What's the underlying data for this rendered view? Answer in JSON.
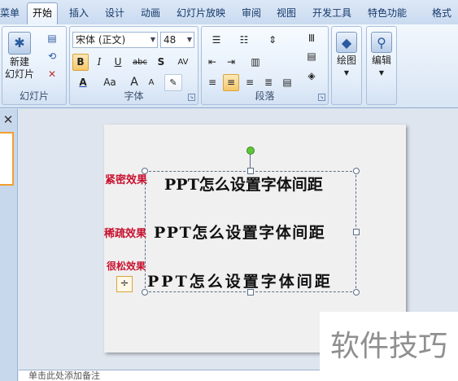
{
  "tabs": {
    "menu": "菜单",
    "home": "开始",
    "insert": "插入",
    "design": "设计",
    "animation": "动画",
    "slideshow": "幻灯片放映",
    "review": "审阅",
    "view": "视图",
    "developer": "开发工具",
    "special": "特色功能",
    "format": "格式"
  },
  "slides_group": {
    "new_slide": "新建",
    "new_slide2": "幻灯片",
    "label": "幻灯片"
  },
  "font_group": {
    "font_name": "宋体 (正文)",
    "font_size": "48",
    "bold": "B",
    "italic": "I",
    "underline": "U",
    "strike": "abc",
    "shadow": "S",
    "spacing": "AV",
    "color": "A",
    "case": "Aa",
    "grow": "A",
    "shrink": "A",
    "label": "字体"
  },
  "paragraph_group": {
    "label": "段落"
  },
  "drawing_group": {
    "label": "绘图"
  },
  "editing_group": {
    "label": "编辑"
  },
  "left_panel": {
    "close": "✕"
  },
  "slide": {
    "label_tight": "紧密效果",
    "label_loose": "稀疏效果",
    "label_very_loose": "很松效果",
    "line1": "PPT怎么设置字体间距",
    "line2": "PPT怎么设置字体间距",
    "line3": "PPT怎么设置字体间距"
  },
  "notes": {
    "placeholder": "单击此处添加备注"
  },
  "watermark": "软件技巧",
  "colors": {
    "label_red": "#c8102e",
    "accent": "#f0a030",
    "rotate_handle": "#5fc63a"
  }
}
